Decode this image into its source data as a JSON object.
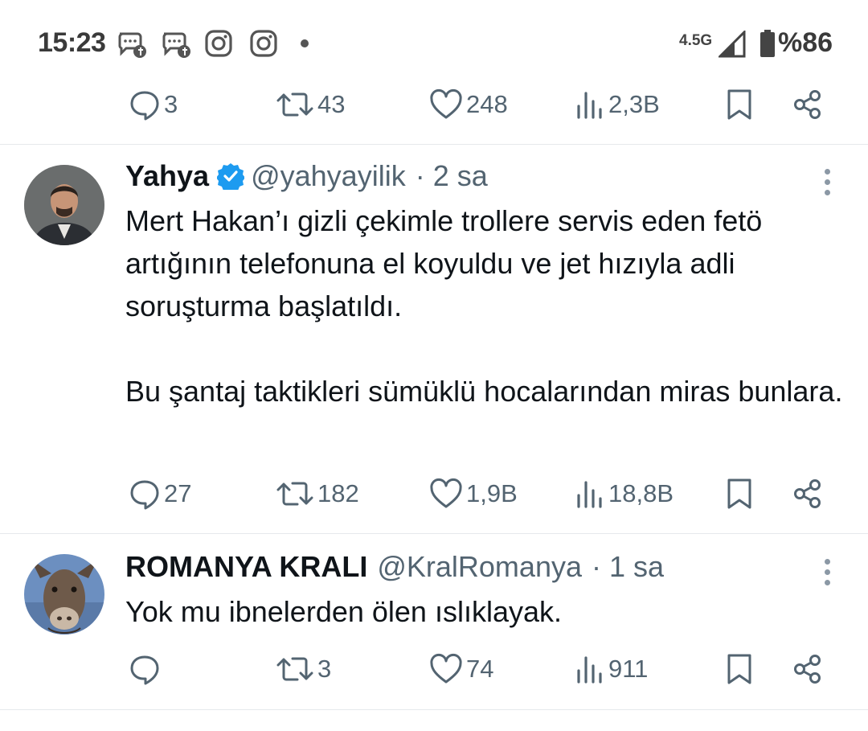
{
  "status_bar": {
    "time": "15:23",
    "icons": [
      "messenger-icon",
      "messenger-icon",
      "instagram-icon",
      "instagram-icon",
      "dot-icon"
    ],
    "network": "4.5G",
    "battery": "%86"
  },
  "top_actions": {
    "replies": "3",
    "retweets": "43",
    "likes": "248",
    "views": "2,3B"
  },
  "tweets": [
    {
      "name": "Yahya",
      "verified": true,
      "handle": "@yahyayilik",
      "time": "· 2 sa",
      "paragraphs": [
        "Mert Hakan’ı gizli çekimle trollere servis eden fetö artığının telefonuna el koyuldu ve jet hızıyla adli soruşturma başlatıldı.",
        "Bu şantaj taktikleri sümüklü hocalarından miras bunlara."
      ],
      "actions": {
        "replies": "27",
        "retweets": "182",
        "likes": "1,9B",
        "views": "18,8B"
      }
    },
    {
      "name": "ROMANYA KRALI",
      "verified": false,
      "handle": "@KralRomanya",
      "time": "· 1 sa",
      "paragraphs": [
        "Yok mu ibnelerden ölen ıslıklayak."
      ],
      "actions": {
        "replies": "",
        "retweets": "3",
        "likes": "74",
        "views": "911"
      }
    }
  ],
  "colors": {
    "text": "#0f1419",
    "secondary": "#536471",
    "verified": "#1d9bf0",
    "divider": "#e6e9ec"
  }
}
